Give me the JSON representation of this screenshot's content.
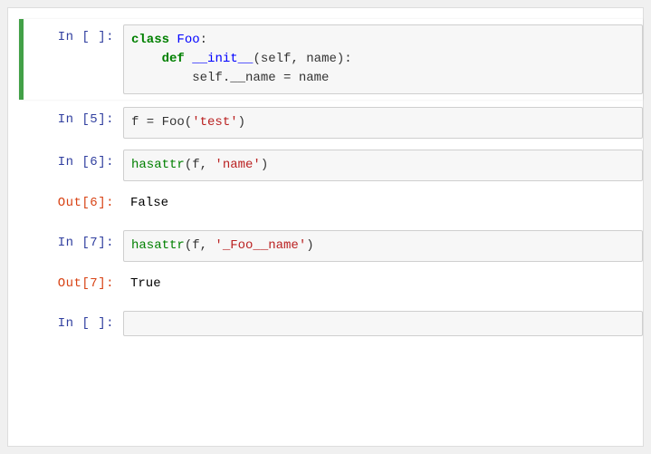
{
  "cells": [
    {
      "prompt_in": "In  [ ]:",
      "selected": true,
      "code_html": "<span class='kw'>class</span> <span class='cls'>Foo</span><span class='plain'>:</span>\n    <span class='kw'>def</span> <span class='fn'>__init__</span><span class='plain'>(self, name):</span>\n        <span class='plain'>self.__name = name</span>"
    },
    {
      "prompt_in": "In  [5]:",
      "code_html": "<span class='plain'>f = Foo(</span><span class='str'>'test'</span><span class='plain'>)</span>"
    },
    {
      "prompt_in": "In  [6]:",
      "code_html": "<span class='call'>hasattr</span><span class='plain'>(f, </span><span class='str'>'name'</span><span class='plain'>)</span>",
      "prompt_out": "Out[6]:",
      "output": "False"
    },
    {
      "prompt_in": "In  [7]:",
      "code_html": "<span class='call'>hasattr</span><span class='plain'>(f, </span><span class='str'>'_Foo__name'</span><span class='plain'>)</span>",
      "prompt_out": "Out[7]:",
      "output": "True"
    },
    {
      "prompt_in": "In  [ ]:",
      "code_html": ""
    }
  ]
}
